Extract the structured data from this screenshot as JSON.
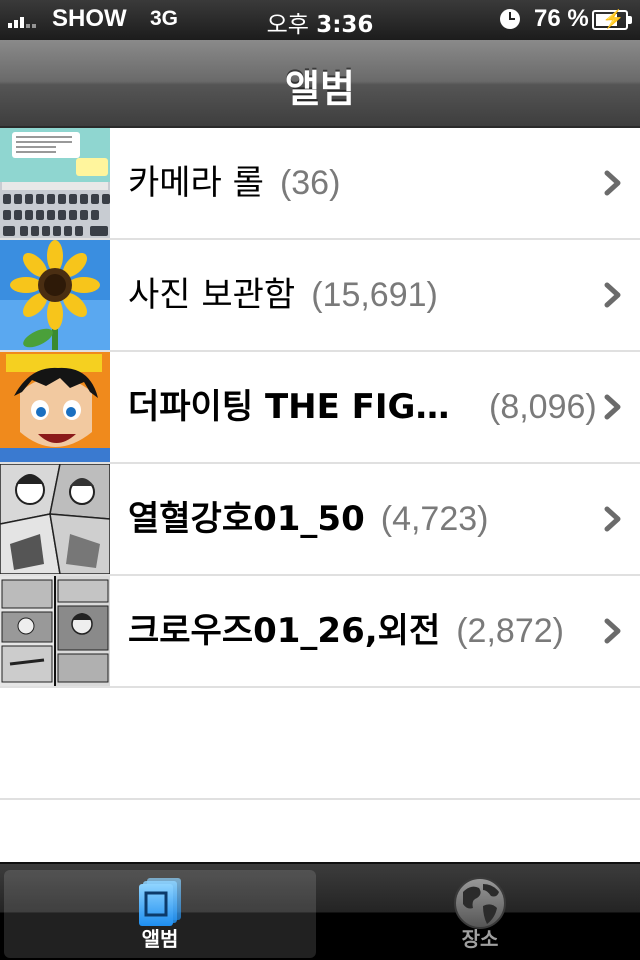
{
  "status": {
    "carrier": "SHOW",
    "network": "3G",
    "time_prefix": "오후",
    "time": "3:36",
    "battery": "76 %",
    "battery_level": 0.76
  },
  "nav": {
    "title": "앨범"
  },
  "albums": [
    {
      "name": "카메라 롤",
      "count": "(36)",
      "thumb_icon": "chat-screenshot-thumbnail"
    },
    {
      "name": "사진 보관함",
      "count": "(15,691)",
      "thumb_icon": "sunflower-thumbnail"
    },
    {
      "name": "더파이팅 THE FIGH…",
      "count": "(8,096)",
      "thumb_icon": "manga-cover-thumbnail"
    },
    {
      "name": "열혈강호01_50",
      "count": "(4,723)",
      "thumb_icon": "manga-page-thumbnail"
    },
    {
      "name": "크로우즈01_26,외전",
      "count": "(2,872)",
      "thumb_icon": "manga-page-thumbnail"
    }
  ],
  "tabs": [
    {
      "label": "앨범",
      "icon": "albums-icon",
      "active": true
    },
    {
      "label": "장소",
      "icon": "globe-icon",
      "active": false
    }
  ],
  "colors": {
    "count_gray": "#7a7a7a",
    "tab_active_blue": "#4fb3ff"
  }
}
